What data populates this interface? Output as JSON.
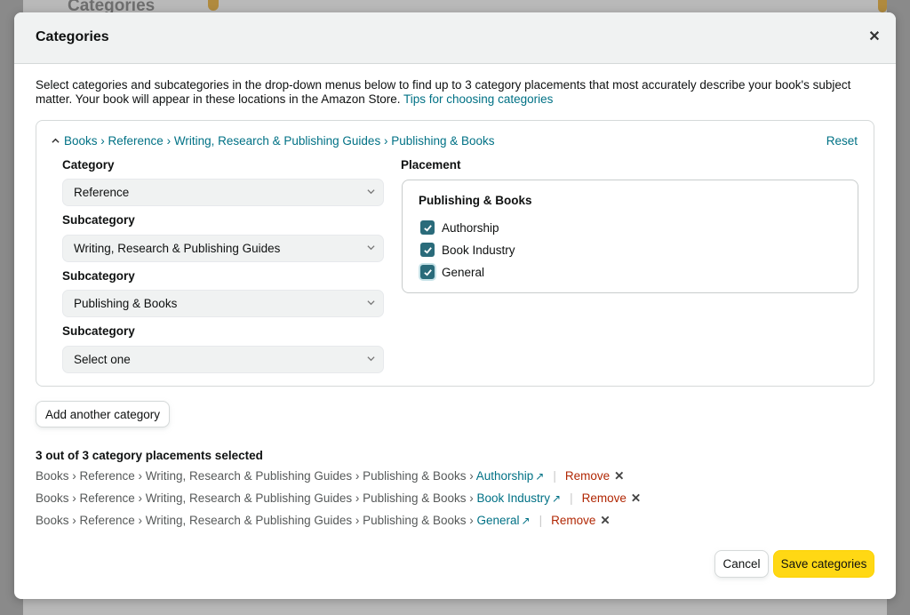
{
  "background": {
    "title": "Categories"
  },
  "modal": {
    "title": "Categories",
    "close_icon": "close-icon",
    "intro_text": "Select categories and subcategories in the drop-down menus below to find up to 3 category placements that most accurately describe your book's subject matter. Your book will appear in these locations in the Amazon Store.",
    "tips_link": "Tips for choosing categories"
  },
  "category_box": {
    "breadcrumb": [
      "Books",
      "Reference",
      "Writing, Research & Publishing Guides",
      "Publishing & Books"
    ],
    "breadcrumb_sep": " › ",
    "collapse_icon": "chevron-up-icon",
    "reset_label": "Reset",
    "category_label": "Category",
    "category_value": "Reference",
    "subcategory_label": "Subcategory",
    "subcategory1_value": "Writing, Research & Publishing Guides",
    "subcategory2_value": "Publishing & Books",
    "subcategory3_value": "Select one",
    "placement_label": "Placement",
    "placement_title": "Publishing & Books",
    "placements": [
      {
        "label": "Authorship",
        "checked": true
      },
      {
        "label": "Book Industry",
        "checked": true
      },
      {
        "label": "General",
        "checked": true
      }
    ]
  },
  "add_category_label": "Add another category",
  "summary": {
    "title": "3 out of 3 category placements selected",
    "path": "Books › Reference › Writing, Research & Publishing Guides › Publishing & Books › ",
    "rows": [
      {
        "leaf": "Authorship"
      },
      {
        "leaf": "Book Industry"
      },
      {
        "leaf": "General"
      }
    ],
    "external_icon": "external-link-icon",
    "separator": "|",
    "remove_label": "Remove",
    "remove_icon": "close-icon"
  },
  "footer": {
    "cancel_label": "Cancel",
    "save_label": "Save categories"
  },
  "colors": {
    "link": "#007185",
    "remove": "#b12704",
    "save_button": "#ffd814",
    "checkbox": "#2a6b7a"
  }
}
